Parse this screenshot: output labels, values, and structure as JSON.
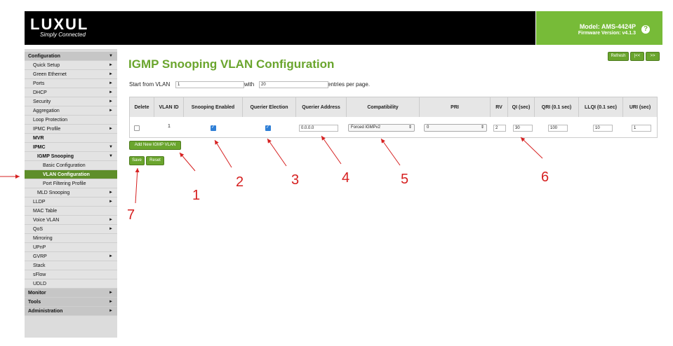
{
  "header": {
    "logo": "LUXUL",
    "tagline": "Simply Connected",
    "model": "Model: AMS-4424P",
    "firmware": "Firmware Version: v4.1.3",
    "help_glyph": "?"
  },
  "sidebar": {
    "items": [
      {
        "label": "Configuration",
        "arrow": "▼"
      },
      {
        "label": "Quick Setup",
        "arrow": "►"
      },
      {
        "label": "Green Ethernet",
        "arrow": "►"
      },
      {
        "label": "Ports",
        "arrow": "►"
      },
      {
        "label": "DHCP",
        "arrow": "►"
      },
      {
        "label": "Security",
        "arrow": "►"
      },
      {
        "label": "Aggregation",
        "arrow": "►"
      },
      {
        "label": "Loop Protection",
        "arrow": ""
      },
      {
        "label": "IPMC Profile",
        "arrow": "►"
      },
      {
        "label": "MVR",
        "arrow": ""
      },
      {
        "label": "IPMC",
        "arrow": "▼"
      },
      {
        "label": "IGMP Snooping",
        "arrow": "▼"
      },
      {
        "label": "Basic Configuration",
        "arrow": ""
      },
      {
        "label": "VLAN Configuration",
        "arrow": ""
      },
      {
        "label": "Port Filtering Profile",
        "arrow": ""
      },
      {
        "label": "MLD Snooping",
        "arrow": "►"
      },
      {
        "label": "LLDP",
        "arrow": "►"
      },
      {
        "label": "MAC Table",
        "arrow": ""
      },
      {
        "label": "Voice VLAN",
        "arrow": "►"
      },
      {
        "label": "QoS",
        "arrow": "►"
      },
      {
        "label": "Mirroring",
        "arrow": ""
      },
      {
        "label": "UPnP",
        "arrow": ""
      },
      {
        "label": "GVRP",
        "arrow": "►"
      },
      {
        "label": "Stack",
        "arrow": ""
      },
      {
        "label": "sFlow",
        "arrow": ""
      },
      {
        "label": "UDLD",
        "arrow": ""
      },
      {
        "label": "Monitor",
        "arrow": "►"
      },
      {
        "label": "Tools",
        "arrow": "►"
      },
      {
        "label": "Administration",
        "arrow": "►"
      }
    ]
  },
  "main": {
    "title": "IGMP Snooping VLAN Configuration",
    "buttons": {
      "refresh": "Refresh",
      "first": "|<<",
      "next": ">>",
      "add": "Add New IGMP VLAN",
      "save": "Save",
      "reset": "Reset"
    },
    "paging": {
      "start_label": "Start from VLAN",
      "start_value": "1",
      "with_label": "with",
      "entries_value": "20",
      "per_page_label": "entries per page."
    },
    "table": {
      "headers": [
        "Delete",
        "VLAN ID",
        "Snooping Enabled",
        "Querier Election",
        "Querier Address",
        "Compatibility",
        "PRI",
        "RV",
        "QI (sec)",
        "QRI (0.1 sec)",
        "LLQI (0.1 sec)",
        "URI (sec)"
      ],
      "row": {
        "vlan_id": "1",
        "delete_checked": false,
        "snooping_checked": true,
        "querier_checked": true,
        "querier_address": "0.0.0.0",
        "compatibility": "Forced IGMPv2",
        "pri": "0",
        "rv": "2",
        "qi": "30",
        "qri": "100",
        "llqi": "10",
        "uri": "1"
      }
    }
  },
  "annotations": {
    "labels": [
      "1",
      "2",
      "3",
      "4",
      "5",
      "6",
      "7"
    ]
  },
  "colors": {
    "accent": "#6aa52d",
    "model_bg": "#77bb38",
    "annotation": "#d62020"
  }
}
